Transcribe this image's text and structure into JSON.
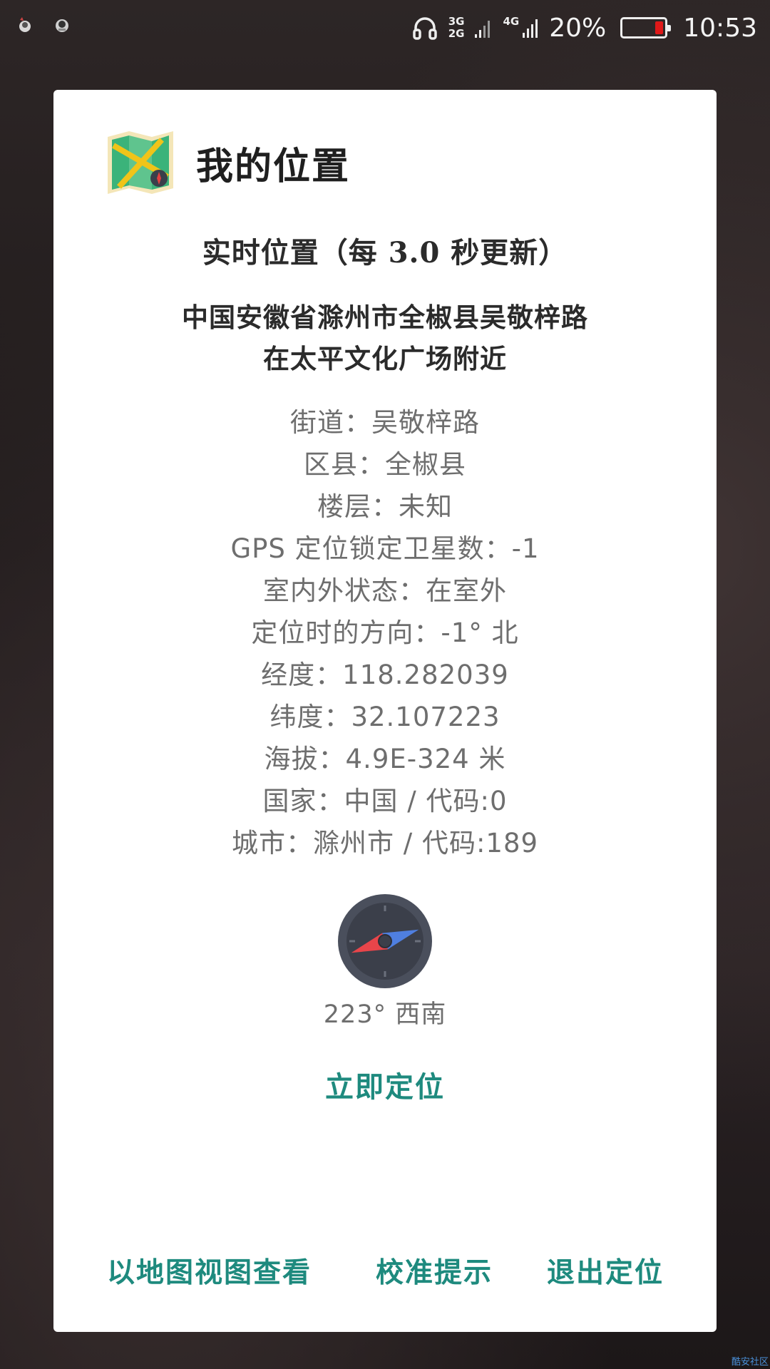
{
  "status_bar": {
    "net_top": "3G",
    "net_bottom": "2G",
    "net2": "4G",
    "battery_percent": "20%",
    "battery_level": 0.2,
    "battery_color": "#e01818",
    "time": "10:53"
  },
  "dialog": {
    "title": "我的位置",
    "realtime_label": "实时位置（每 3.0 秒更新）",
    "address_line1": "中国安徽省滁州市全椒县吴敬梓路",
    "address_line2": "在太平文化广场附近",
    "info": [
      "街道：吴敬梓路",
      "区县：全椒县",
      "楼层：未知",
      "GPS 定位锁定卫星数：-1",
      "室内外状态：在室外",
      "定位时的方向：-1° 北",
      "经度：118.282039",
      "纬度：32.107223",
      "海拔：4.9E-324 米",
      "国家：中国 / 代码:0",
      "城市：滁州市 / 代码:189"
    ],
    "compass_heading_deg": 223,
    "compass_label": "223° 西南",
    "locate_now": "立即定位",
    "actions": {
      "map_view": "以地图视图查看",
      "calibrate": "校准提示",
      "exit": "退出定位"
    }
  },
  "colors": {
    "accent": "#1e8a7e",
    "text_dark": "#2b2b2b",
    "text_gray": "#6e6e6e"
  },
  "watermark": "酷安社区"
}
